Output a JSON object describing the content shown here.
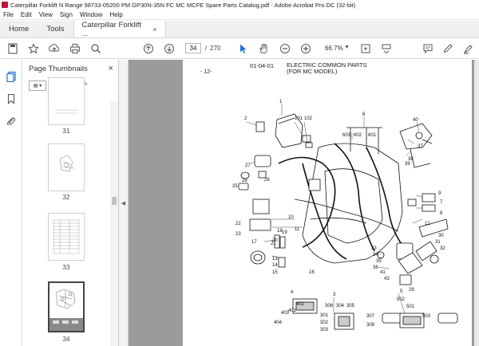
{
  "window": {
    "title": "Caterpillar Forklift N Range  98733-05200 PM GP30N-35N FC MC MCFE Spare Parts Catalog.pdf - Adobe Acrobat Pro DC (32-bit)"
  },
  "menu": [
    "File",
    "Edit",
    "View",
    "Sign",
    "Window",
    "Help"
  ],
  "tabs": {
    "home": "Home",
    "tools": "Tools",
    "document": "Caterpillar Forklift ...",
    "close": "×"
  },
  "toolbar": {
    "page_current": "34",
    "page_sep": "/",
    "page_total": "270",
    "zoom": "66.7%",
    "icons": [
      "save-icon",
      "bookmark-star-icon",
      "upload-icon",
      "print-icon",
      "search-zoom-icon",
      "page-up-icon",
      "page-down-icon",
      "select-cursor-icon",
      "hand-icon",
      "zoom-out-icon",
      "zoom-in-icon",
      "zoom-dropdown-icon",
      "fit-page-icon",
      "scroll-mode-icon",
      "comment-icon",
      "pen-icon",
      "highlight-icon",
      "sign-icon"
    ]
  },
  "thumb_panel": {
    "title": "Page Thumbnails",
    "close": "×",
    "pages": [
      {
        "num": "31"
      },
      {
        "num": "32"
      },
      {
        "num": "33"
      },
      {
        "num": "34",
        "selected": true
      }
    ]
  },
  "document": {
    "section_code": "01-04-01",
    "title_line1": "ELECTRIC COMMON PARTS",
    "title_line2": "(FOR MC MODEL)",
    "page_label": "- 12-",
    "callouts": [
      "1",
      "2",
      "101",
      "102",
      "6",
      "603",
      "602",
      "601",
      "40",
      "37",
      "39",
      "38",
      "27",
      "26",
      "28",
      "25",
      "9",
      "7",
      "8",
      "10",
      "11",
      "12",
      "22",
      "23",
      "17",
      "18",
      "19",
      "20",
      "21",
      "13",
      "14",
      "15",
      "16",
      "36",
      "35",
      "34",
      "33",
      "41",
      "43",
      "29",
      "30",
      "31",
      "32",
      "3",
      "306",
      "304",
      "305",
      "4",
      "402",
      "401",
      "403",
      "404",
      "301",
      "302",
      "303",
      "307",
      "308",
      "5",
      "502",
      "501",
      "503"
    ]
  }
}
